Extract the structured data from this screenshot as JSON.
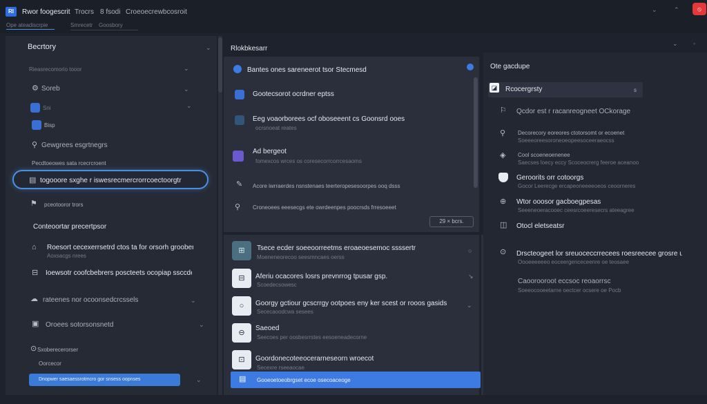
{
  "app": {
    "logo": "Rl",
    "title": "Rwor foogescrit",
    "menu": [
      "Trocrs",
      "8 fsodi",
      "Croeoecrewbcosroit"
    ],
    "subnav": [
      "Ope ateadiscrpie",
      "Smrecetr",
      "Goosbory"
    ]
  },
  "window_controls": {
    "collapse": "⌄",
    "menu": "⌃",
    "record": "⦸"
  },
  "left": {
    "header": "Becrtory",
    "section1": "Rieasrecomorio tooor",
    "items": [
      {
        "label": "Soreb"
      },
      {
        "label": "Sni"
      },
      {
        "label": "Bisp"
      },
      {
        "label": "Gewgrees esgrtnegrs"
      }
    ],
    "section2": "Pecdtoeowes sata rcecrcroent",
    "selected": "togooore sxghe r iswesrecmercrorrcoectoorgtr",
    "item_after": "pceotooror trors",
    "group_header": "Conteoortar precertpsor",
    "rows": [
      {
        "title": "Roesort cecexerrsetrd ctos ta for orsorh groobersg",
        "sub": "Aoxsacgs nrees"
      },
      {
        "title": "Ioewsotr coofcbebrers poscteets ocopiap ssccdes",
        "sub": ""
      },
      {
        "title": "rateenes nor ocoonsedcrcssels",
        "sub": ""
      },
      {
        "title": "Oroees sotorsonsnetd",
        "sub": ""
      },
      {
        "title": "Sxoberecerorser",
        "sub": ""
      },
      {
        "title": "Oorcecor",
        "sub": ""
      }
    ],
    "primary_button": "Dnopwer saesaessrotmcro gor snsess oopnses"
  },
  "middle": {
    "header": "Rlokbkesarr",
    "top_items": [
      {
        "title": "Bantes ones sareneerot tsor Stecmesd",
        "sub": ""
      },
      {
        "title": "Gootecsorot ocrdner eptss",
        "sub": ""
      },
      {
        "title": "Eeg voaorborees ocf oboseeent cs Goonsrd ooes",
        "sub": "ocrsnoeat reates"
      },
      {
        "title": "Ad bergeot",
        "sub": "fomexcos wrces os coresecorrcorrcesaoms"
      },
      {
        "title": "Acore iwrraerdes nsnstenaes teerteropesesoorpes ooq dsss",
        "sub": ""
      },
      {
        "title": "Croneoees eeesecgs ete owrdeenpes poocrsds frresoeeet",
        "sub": ""
      }
    ],
    "count_pill": "29 × bcrs.",
    "cards": [
      {
        "icon": "⊞",
        "title": "Tsece ecder soeeoorreetms eroaeoesemoc ssssertr",
        "sub": "Moeneneorecoo seesmncaes oerss"
      },
      {
        "icon": "⊟",
        "title": "Aferiu ocacores losrs prevnrrog tpusar gsp.",
        "sub": "Scoedecsowesc"
      },
      {
        "icon": "○",
        "title": "Goorgy gctiour gcscrrgy ootpoes eny ker scest or rooos gasids",
        "sub": "Sececaoodcwa sesees"
      },
      {
        "icon": "⊖",
        "title": "Saeoed",
        "sub": "Seecoes per oosbesrrstes eesoeneadecorne"
      },
      {
        "icon": "⊡",
        "title": "Goordonecoteeocerarneseorn wroecot",
        "sub": "Secexre rseeaocae"
      }
    ],
    "primary_button": "Gooeoetoeobrgset ecoe osecoaceoge"
  },
  "right": {
    "header": "Ote gacdupe",
    "dropdown": "Rcocergrsty",
    "dropdown_value": "s",
    "items": [
      {
        "icon": "⚐",
        "title": "Qcdor est r racanreogneet OCkorage",
        "sub": ""
      },
      {
        "icon": "⚲",
        "title": "Decorecory eoreores ctotorsomt or ecoenet",
        "sub": "Soeeeoreesoroneoeopeesoceeraeocss"
      },
      {
        "icon": "◈",
        "title": "Cool scoeneoenenee",
        "sub": "Saecses loecy eccy Scoceocrerg feeroe aceanoo"
      },
      {
        "icon": "⛨",
        "title": "Geroorits orr cotoorgs",
        "sub": "Gocor Leerecge ercapeoneeeeoeos ceoorneres"
      },
      {
        "icon": "⊕",
        "title": "Wtor ooosor gacboegpesas",
        "sub": "Seeeneoeracooec ceesrcoeeresecrs ateeagree"
      },
      {
        "icon": "◫",
        "title": "Otocl eletseatsr",
        "sub": ""
      },
      {
        "icon": "⊙",
        "title": "Drscteogeet lor sreuoceccrrecees roesreecee grosre usr",
        "sub": "Oooeeeeeeo eoceergenceceenre oe teosaee"
      },
      {
        "icon": "",
        "title": "Caoorooroot eccsoc reoaorrsc",
        "sub": "Soeeocooeetarne oectcer ocsere oe Pocb"
      }
    ]
  }
}
